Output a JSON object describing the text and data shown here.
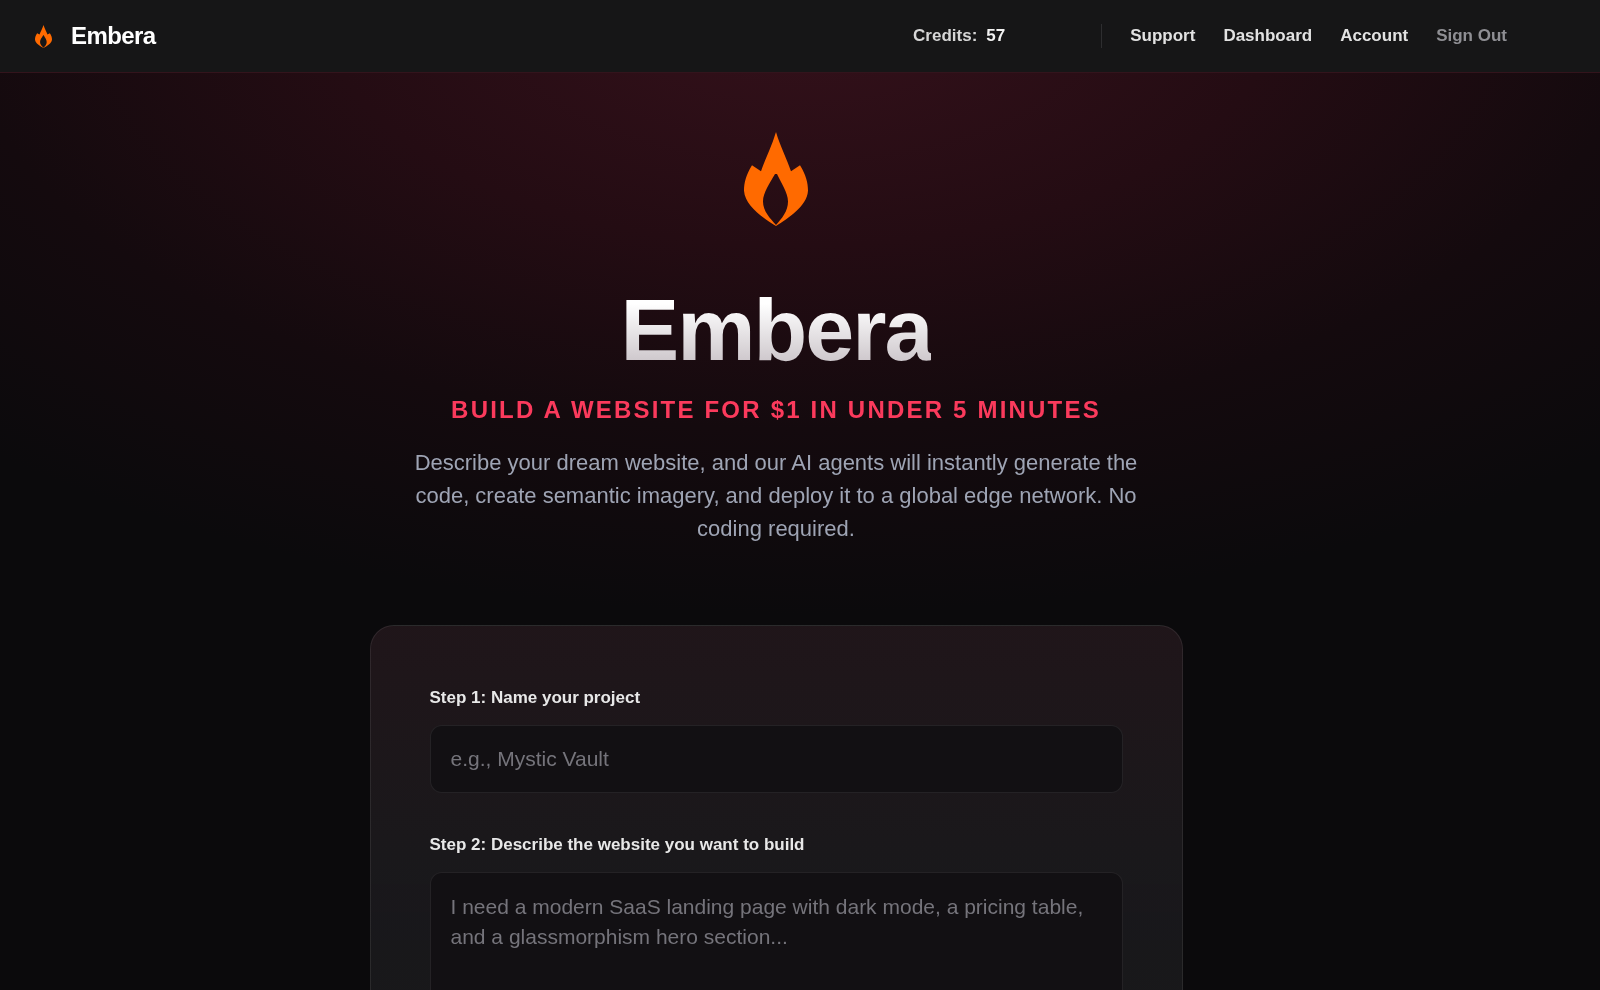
{
  "header": {
    "brand": "Embera",
    "credits": {
      "label": "Credits:",
      "value": "57"
    },
    "nav": [
      {
        "label": "Support",
        "kind": "link"
      },
      {
        "label": "Dashboard",
        "kind": "link"
      },
      {
        "label": "Account",
        "kind": "link"
      },
      {
        "label": "Sign Out",
        "kind": "muted"
      }
    ]
  },
  "hero": {
    "title": "Embera",
    "tagline": "BUILD A WEBSITE FOR $1 IN UNDER 5 MINUTES",
    "description": "Describe your dream website, and our AI agents will instantly generate the code, create semantic imagery, and deploy it to a global edge network. No coding required."
  },
  "form": {
    "fields": [
      {
        "label": "Step 1: Name your project",
        "kind": "input",
        "placeholder": "e.g., Mystic Vault"
      },
      {
        "label": "Step 2: Describe the website you want to build",
        "kind": "textarea",
        "placeholder": "I need a modern SaaS landing page with dark mode, a pricing table, and a glassmorphism hero section..."
      }
    ]
  }
}
